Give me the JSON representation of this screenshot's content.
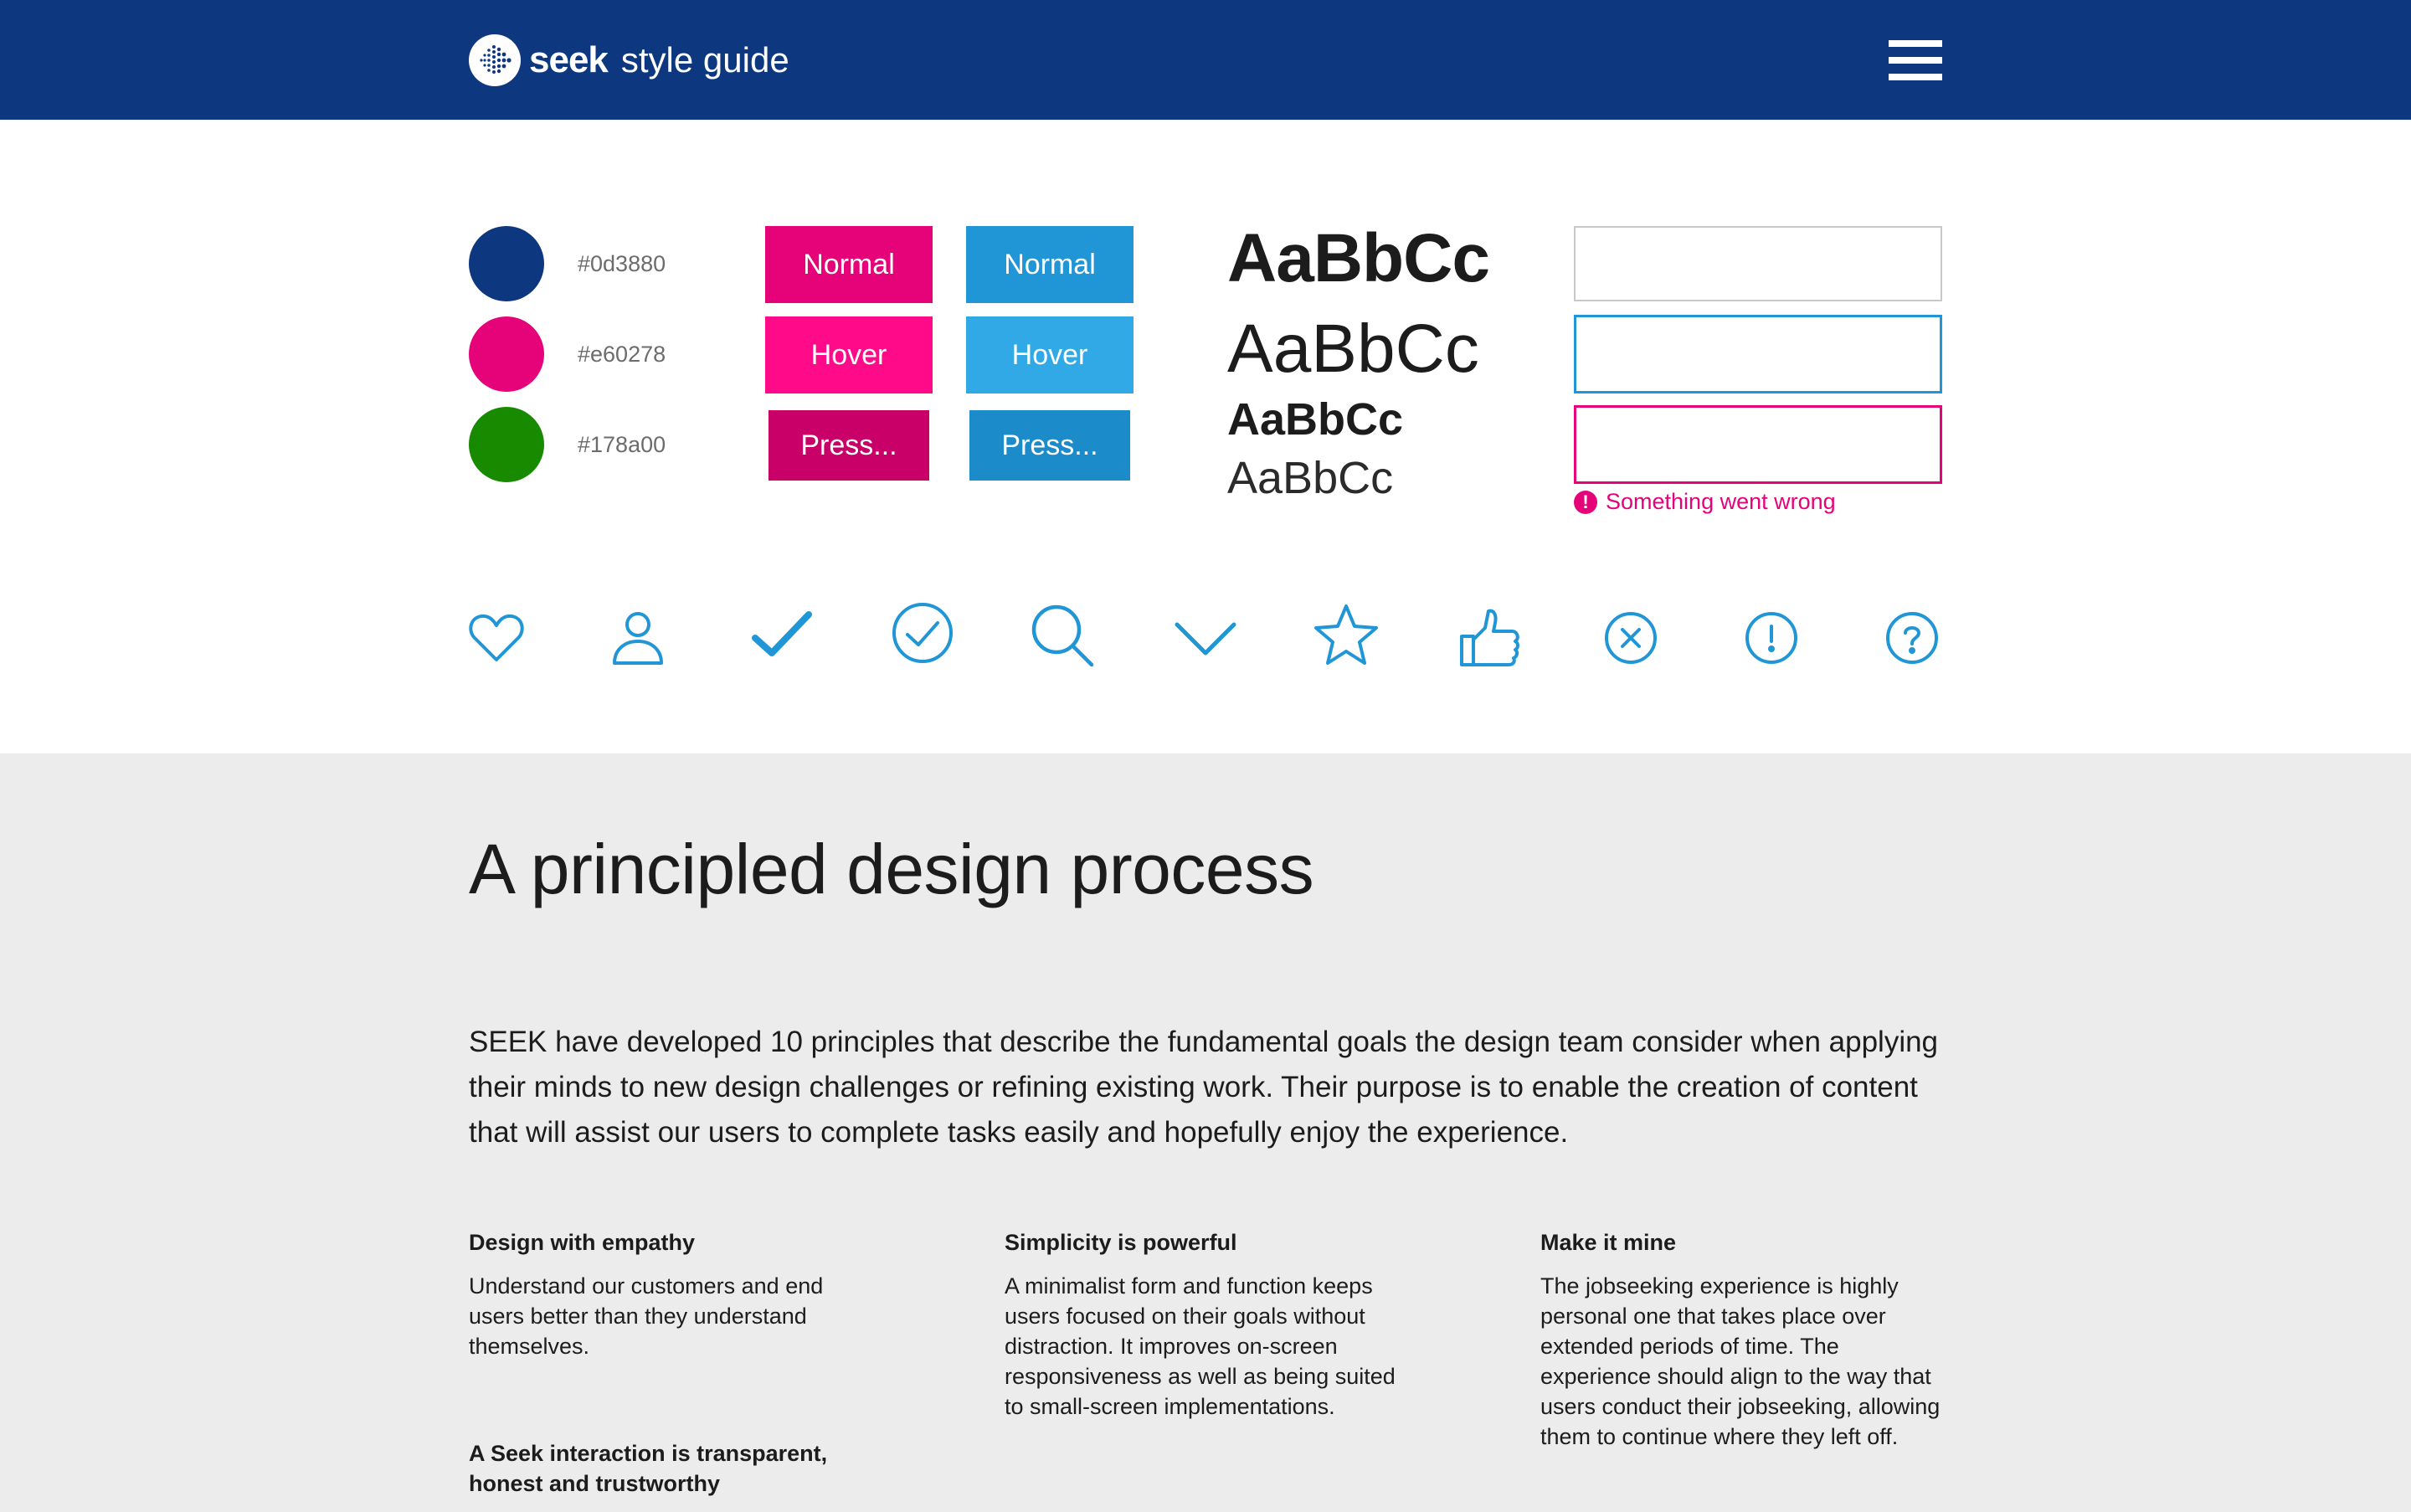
{
  "header": {
    "logo_word": "seek",
    "logo_sub": "style guide",
    "menu_icon": "hamburger-menu-icon"
  },
  "colors": [
    {
      "name": "blue",
      "hex": "#0d3880",
      "label": "#0d3880"
    },
    {
      "name": "pink",
      "hex": "#e60278",
      "label": "#e60278"
    },
    {
      "name": "green",
      "hex": "#178a00",
      "label": "#178a00"
    }
  ],
  "buttons": {
    "pink": {
      "normal": "Normal",
      "hover": "Hover",
      "pressed": "Press...",
      "colors": {
        "normal": "#e60278",
        "hover": "#ff0a88",
        "pressed": "#c90068"
      }
    },
    "blue": {
      "normal": "Normal",
      "hover": "Hover",
      "pressed": "Press...",
      "colors": {
        "normal": "#2196d6",
        "hover": "#31a9e6",
        "pressed": "#1b8bc9"
      }
    }
  },
  "typography": {
    "samples": [
      "AaBbCc",
      "AaBbCc",
      "AaBbCc",
      "AaBbCc"
    ]
  },
  "fields": {
    "states": [
      {
        "state": "default",
        "value": "",
        "border": "#c8c8c8"
      },
      {
        "state": "focus",
        "value": "",
        "border": "#2196d6"
      },
      {
        "state": "error",
        "value": "",
        "border": "#e60278"
      }
    ],
    "error_message": "Something went wrong"
  },
  "icons": {
    "color": "#2196d6",
    "names": [
      "heart-icon",
      "user-icon",
      "tick-icon",
      "tick-circle-icon",
      "search-icon",
      "chevron-down-icon",
      "star-icon",
      "thumbs-up-icon",
      "cross-circle-icon",
      "alert-circle-icon",
      "help-circle-icon"
    ]
  },
  "section": {
    "title": "A principled design process",
    "intro": "SEEK have developed 10 principles that describe the fundamental goals the design team consider when applying their minds to new design challenges or refining existing work. Their purpose is to enable the creation of content that will assist our users to complete tasks easily and hopefully enjoy the experience."
  },
  "principles": [
    {
      "title": "Design with empathy",
      "body": "Understand our customers and end users better than they understand themselves."
    },
    {
      "title": "Simplicity is powerful",
      "body": "A minimalist form and function keeps users focused on their goals without distraction. It improves on-screen responsiveness as well as being suited to small-screen implementations."
    },
    {
      "title": "Make it mine",
      "body": "The jobseeking experience is highly personal one that takes place over extended periods of time. The experience should align to the way that users conduct their jobseeking, allowing them to continue where they left off."
    },
    {
      "title": "A Seek interaction is transparent, honest and trustworthy",
      "body": ""
    }
  ]
}
